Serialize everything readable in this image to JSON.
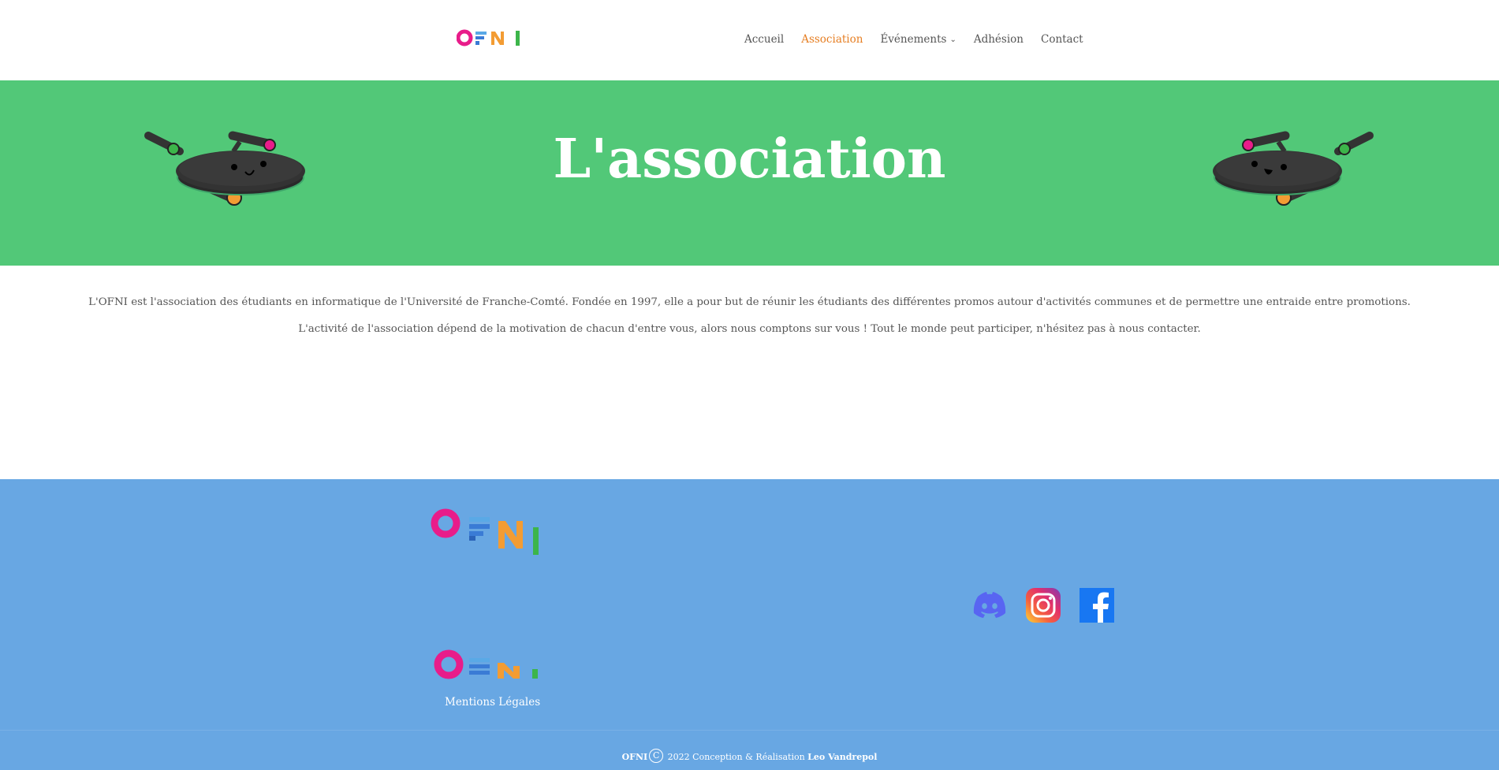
{
  "header": {
    "logo_text": "OFNI",
    "nav": [
      {
        "label": "Accueil",
        "active": false,
        "has_dropdown": false
      },
      {
        "label": "Association",
        "active": true,
        "has_dropdown": false
      },
      {
        "label": "Événements",
        "active": false,
        "has_dropdown": true
      },
      {
        "label": "Adhésion",
        "active": false,
        "has_dropdown": false
      },
      {
        "label": "Contact",
        "active": false,
        "has_dropdown": false
      }
    ]
  },
  "hero": {
    "title": "L'association",
    "background": "#52c878",
    "decoration_icon": "wok-mascot-icon"
  },
  "content": {
    "paragraph_1": "L'OFNI est l'association des étudiants en informatique de l'Université de Franche-Comté. Fondée en 1997, elle a pour but de réunir les étudiants des différentes promos autour d'activités communes et de permettre une entraide entre promotions.",
    "paragraph_2": "L'activité de l'association dépend de la motivation de chacun d'entre vous, alors nous comptons sur vous ! Tout le monde peut participer, n'hésitez pas à nous contacter."
  },
  "footer": {
    "background": "#68a7e3",
    "logo_text": "OFNI",
    "legal_link": "Mentions Légales",
    "socials": [
      {
        "name": "discord",
        "icon": "discord-icon"
      },
      {
        "name": "instagram",
        "icon": "instagram-icon"
      },
      {
        "name": "facebook",
        "icon": "facebook-icon"
      }
    ],
    "copyright": {
      "brand": "OFNI",
      "symbol": "C",
      "text": "2022 Conception & Réalisation",
      "author": "Leo Vandrepol"
    }
  },
  "colors": {
    "accent": "#e67e22",
    "logo_pink": "#e81c8a",
    "logo_blue": "#3a7bd5",
    "logo_orange": "#f39c33",
    "logo_green": "#3cb54a"
  }
}
